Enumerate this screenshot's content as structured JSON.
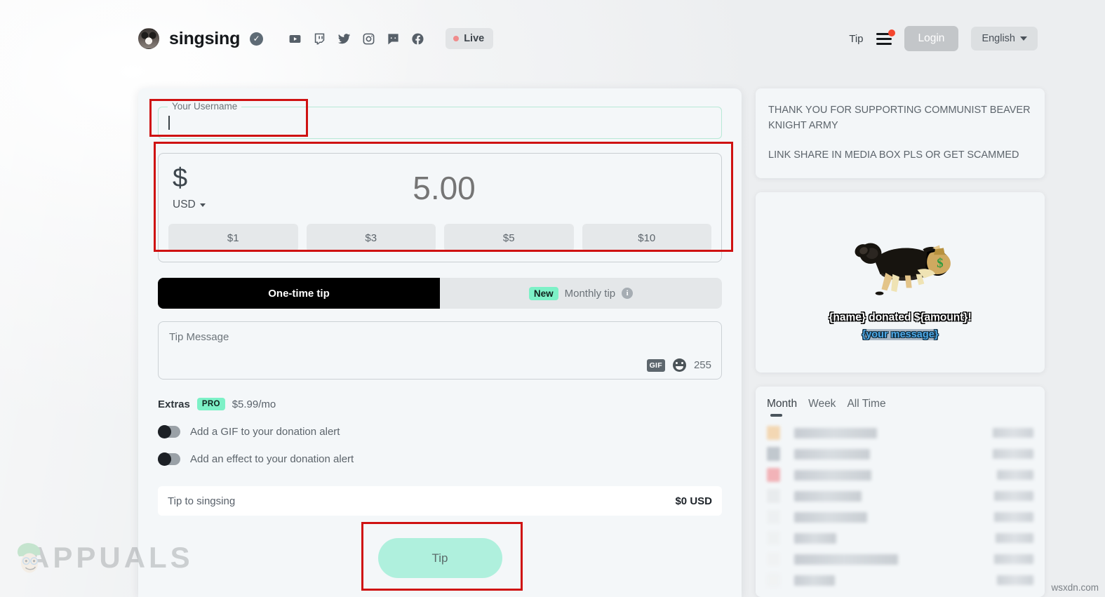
{
  "header": {
    "channel_name": "singsing",
    "verified_icon": "verified-check-icon",
    "socials": [
      {
        "name": "youtube-icon",
        "label": "YouTube"
      },
      {
        "name": "twitch-icon",
        "label": "Twitch"
      },
      {
        "name": "twitter-icon",
        "label": "Twitter"
      },
      {
        "name": "instagram-icon",
        "label": "Instagram"
      },
      {
        "name": "discord-icon",
        "label": "Discord"
      },
      {
        "name": "facebook-icon",
        "label": "Facebook"
      }
    ],
    "live_label": "Live",
    "tip_link": "Tip",
    "login_label": "Login",
    "language_label": "English",
    "menu_icon": "hamburger-menu-icon",
    "menu_has_notification": true
  },
  "form": {
    "username": {
      "legend": "Your Username",
      "value": "",
      "placeholder": ""
    },
    "amount": {
      "currency_symbol": "$",
      "currency_code": "USD",
      "value": "",
      "placeholder": "5.00",
      "quick_amounts": [
        "$1",
        "$3",
        "$5",
        "$10"
      ]
    },
    "tabs": [
      {
        "label": "One-time tip",
        "active": true
      },
      {
        "label": "Monthly tip",
        "active": false,
        "badge": "New",
        "info_icon": "info-icon"
      }
    ],
    "message": {
      "placeholder": "Tip Message",
      "value": "",
      "char_count": "255",
      "gif_label": "GIF",
      "emoji_icon": "emoji-icon"
    },
    "extras": {
      "title": "Extras",
      "badge": "PRO",
      "price": "$5.99/mo",
      "options": [
        {
          "label": "Add a GIF to your donation alert",
          "enabled": false
        },
        {
          "label": "Add an effect to your donation alert",
          "enabled": false
        }
      ]
    },
    "total": {
      "label": "Tip to singsing",
      "value": "$0 USD"
    },
    "submit_label": "Tip"
  },
  "sidebar": {
    "notice": [
      "THANK YOU FOR SUPPORTING COMMUNIST BEAVER KNIGHT ARMY",
      "LINK SHARE IN MEDIA BOX PLS OR GET SCAMMED"
    ],
    "alert_preview": {
      "image": "dog-with-money-bag",
      "line1": "{name} donated ${amount}!",
      "line2": "{your message}"
    },
    "leaderboard": {
      "tabs": [
        {
          "label": "Month",
          "active": true
        },
        {
          "label": "Week",
          "active": false
        },
        {
          "label": "All Time",
          "active": false
        }
      ],
      "rows": [
        {
          "rank_color": "#f3d2a8",
          "name_width": 118,
          "amount_width": 58
        },
        {
          "rank_color": "#b9c0c7",
          "name_width": 108,
          "amount_width": 58
        },
        {
          "rank_color": "#f2a8ad",
          "name_width": 110,
          "amount_width": 52
        },
        {
          "rank_color": "#e7eaec",
          "name_width": 96,
          "amount_width": 56
        },
        {
          "rank_color": "#edf0f1",
          "name_width": 104,
          "amount_width": 56
        },
        {
          "rank_color": "#eef1f2",
          "name_width": 60,
          "amount_width": 54
        },
        {
          "rank_color": "#f0f2f3",
          "name_width": 148,
          "amount_width": 56
        },
        {
          "rank_color": "#f0f2f3",
          "name_width": 58,
          "amount_width": 52
        }
      ]
    }
  },
  "annotations": {
    "color": "#cf1212",
    "boxes": [
      "username-field",
      "amount-section",
      "tip-button"
    ]
  },
  "watermarks": {
    "brand": "APPUALS",
    "source": "wsxdn.com"
  },
  "colors": {
    "accent_mint": "#7df1c7",
    "tip_button": "#aff0dd",
    "tab_active": "#000000",
    "annotation_red": "#cf1212"
  }
}
